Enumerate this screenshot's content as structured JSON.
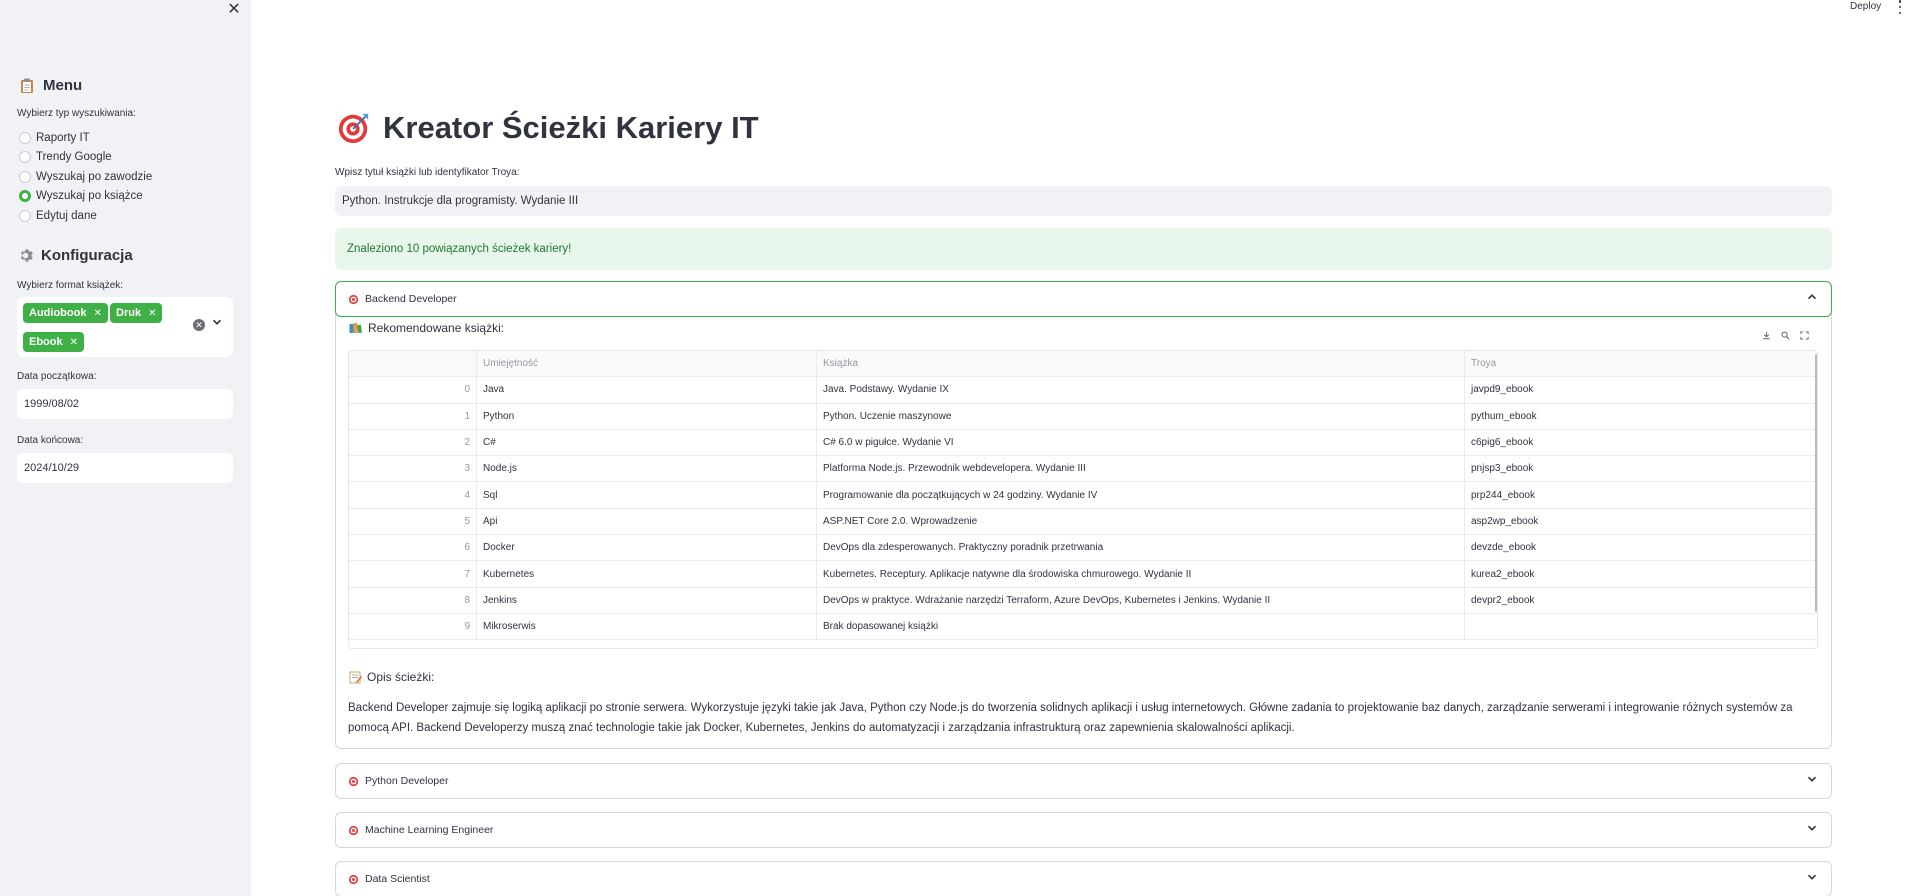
{
  "sidebar": {
    "menu_title": "Menu",
    "search_type_label": "Wybierz typ wyszukiwania:",
    "search_types": [
      {
        "label": "Raporty IT",
        "selected": false
      },
      {
        "label": "Trendy Google",
        "selected": false
      },
      {
        "label": "Wyszukaj po zawodzie",
        "selected": false
      },
      {
        "label": "Wyszukaj po książce",
        "selected": true
      },
      {
        "label": "Edytuj dane",
        "selected": false
      }
    ],
    "config_title": "Konfiguracja",
    "format_label": "Wybierz format książek:",
    "formats": [
      "Audiobook",
      "Druk",
      "Ebook"
    ],
    "start_date_label": "Data początkowa:",
    "start_date": "1999/08/02",
    "end_date_label": "Data końcowa:",
    "end_date": "2024/10/29"
  },
  "topbar": {
    "deploy_label": "Deploy"
  },
  "main": {
    "title": "Kreator Ścieżki Kariery IT",
    "input_label": "Wpisz tytuł książki lub identyfikator Troya:",
    "input_value": "Python. Instrukcje dla programisty. Wydanie III",
    "success_message": "Znaleziono 10 powiązanych ścieżek kariery!",
    "expanders": [
      {
        "label": "Backend Developer",
        "open": true
      },
      {
        "label": "Python Developer",
        "open": false
      },
      {
        "label": "Machine Learning Engineer",
        "open": false
      },
      {
        "label": "Data Scientist",
        "open": false
      }
    ],
    "books_title": "Rekomendowane książki:",
    "table": {
      "columns": [
        "",
        "Umiejętność",
        "Książka",
        "Troya"
      ],
      "rows": [
        [
          "0",
          "Java",
          "Java. Podstawy. Wydanie IX",
          "javpd9_ebook"
        ],
        [
          "1",
          "Python",
          "Python. Uczenie maszynowe",
          "pythum_ebook"
        ],
        [
          "2",
          "C#",
          "C# 6.0 w pigułce. Wydanie VI",
          "c6pig6_ebook"
        ],
        [
          "3",
          "Node.js",
          "Platforma Node.js. Przewodnik webdevelopera. Wydanie III",
          "pnjsp3_ebook"
        ],
        [
          "4",
          "Sql",
          "Programowanie dla początkujących w 24 godziny. Wydanie IV",
          "prp244_ebook"
        ],
        [
          "5",
          "Api",
          "ASP.NET Core 2.0. Wprowadzenie",
          "asp2wp_ebook"
        ],
        [
          "6",
          "Docker",
          "DevOps dla zdesperowanych. Praktyczny poradnik przetrwania",
          "devzde_ebook"
        ],
        [
          "7",
          "Kubernetes",
          "Kubernetes. Receptury. Aplikacje natywne dla środowiska chmurowego. Wydanie II",
          "kurea2_ebook"
        ],
        [
          "8",
          "Jenkins",
          "DevOps w praktyce. Wdrażanie narzędzi Terraform, Azure DevOps, Kubernetes i Jenkins. Wydanie II",
          "devpr2_ebook"
        ],
        [
          "9",
          "Mikroserwis",
          "Brak dopasowanej książki",
          ""
        ]
      ]
    },
    "description_title": "Opis ścieżki:",
    "description": "Backend Developer zajmuje się logiką aplikacji po stronie serwera. Wykorzystuje języki takie jak Java, Python czy Node.js do tworzenia solidnych aplikacji i usług internetowych. Główne zadania to projektowanie baz danych, zarządzanie serwerami i integrowanie różnych systemów za pomocą API. Backend Developerzy muszą znać technologie takie jak Docker, Kubernetes, Jenkins do automatyzacji i zarządzania infrastrukturą oraz zapewnienia skalowalności aplikacji."
  },
  "colors": {
    "accent": "#3eb046",
    "success_bg": "#e8f6ec",
    "sidebar_bg": "#f0f2f6"
  }
}
